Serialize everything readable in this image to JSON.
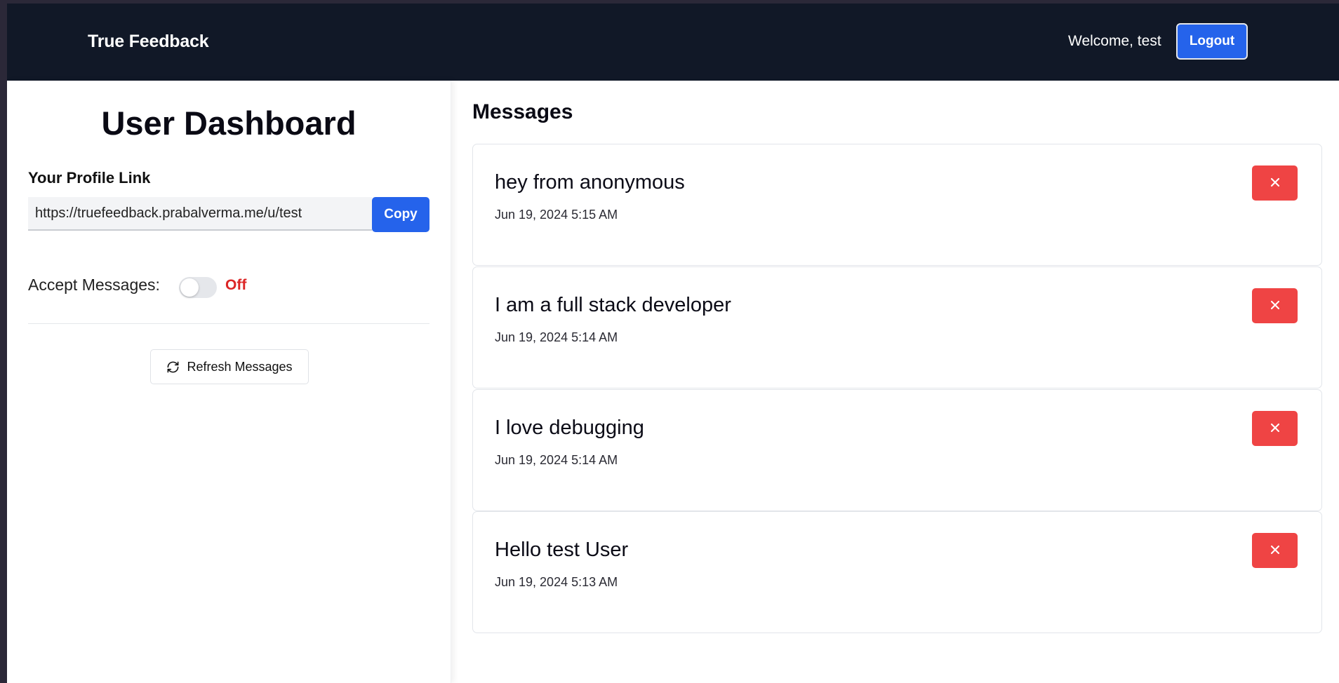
{
  "navbar": {
    "brand": "True Feedback",
    "welcome": "Welcome, test",
    "logout_label": "Logout"
  },
  "dashboard": {
    "title": "User Dashboard",
    "profile_label": "Your Profile Link",
    "profile_link": "https://truefeedback.prabalverma.me/u/test",
    "copy_label": "Copy",
    "accept_label": "Accept Messages:",
    "accept_state": "Off",
    "accept_enabled": false,
    "refresh_label": "Refresh Messages"
  },
  "messages": {
    "title": "Messages",
    "items": [
      {
        "text": "hey from anonymous",
        "date": "Jun 19, 2024 5:15 AM"
      },
      {
        "text": "I am a full stack developer",
        "date": "Jun 19, 2024 5:14 AM"
      },
      {
        "text": "I love debugging",
        "date": "Jun 19, 2024 5:14 AM"
      },
      {
        "text": "Hello test User",
        "date": "Jun 19, 2024 5:13 AM"
      }
    ]
  },
  "colors": {
    "navbar_bg": "#111827",
    "primary": "#2563eb",
    "danger": "#ef4444",
    "off_text": "#dc2626"
  },
  "icons": {
    "refresh": "refresh-icon",
    "delete": "close-icon"
  }
}
